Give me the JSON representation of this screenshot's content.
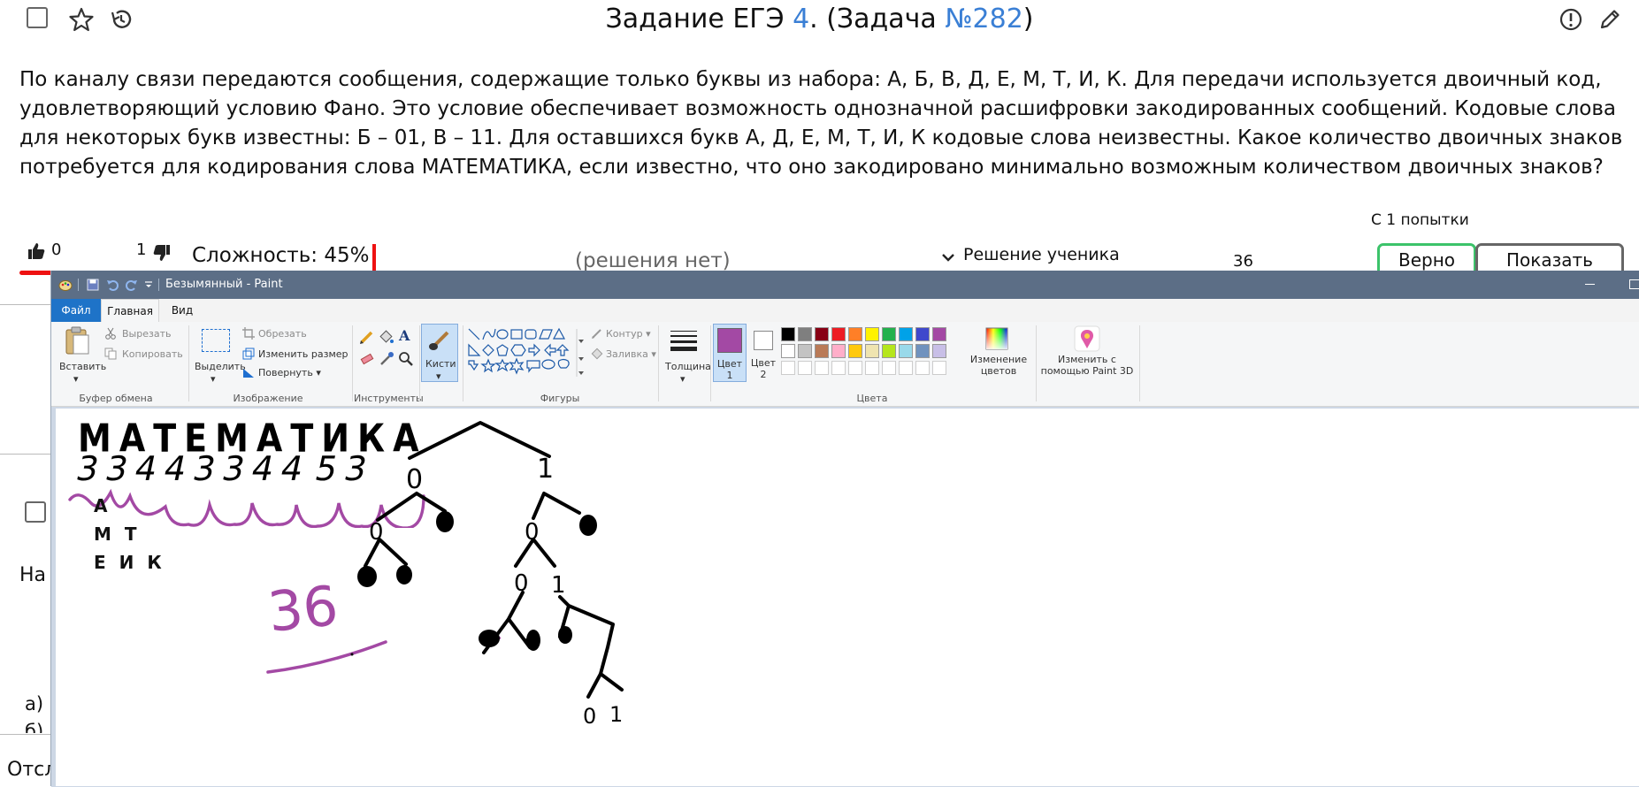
{
  "header": {
    "title_prefix": "Задание ЕГЭ ",
    "task_number": "4",
    "title_mid": ". (Задача ",
    "problem_id": "№282",
    "title_suffix": ")"
  },
  "task": {
    "text": "По каналу связи передаются сообщения, содержащие только буквы из набора: А, Б, В, Д, Е, М, Т, И, К. Для передачи используется двоичный код, удовлетворяющий условию Фано. Это условие обеспечивает возможность однозначной расшифровки закодированных сообщений. Кодовые слова для некоторых букв известны: Б – 01, В – 11. Для оставшихся букв А, Д, Е, М, Т, И, К кодовые слова неизвестны. Какое количество двоичных знаков потребуется для кодирования слова МАТЕМАТИКА, если известно, что оно закодировано минимально возможным количеством двоичных знаков?"
  },
  "stats": {
    "likes": "0",
    "dislikes": "1",
    "difficulty": "Сложность: 45%",
    "solutions": "(решения нет)",
    "student_solution": "Решение ученика",
    "answer_value": "36",
    "attempts": "С 1 попытки",
    "correct_label": "Верно",
    "show_answer_label": "Показать ответ"
  },
  "background_fragments": {
    "left_na": "На",
    "item_a": "а)",
    "item_b": "б)",
    "bottom": "Отсл"
  },
  "paint": {
    "window_title": "Безымянный - Paint",
    "tabs": [
      "Файл",
      "Главная",
      "Вид"
    ],
    "clipboard": {
      "paste": "Вставить",
      "cut": "Вырезать",
      "copy": "Копировать",
      "label": "Буфер обмена"
    },
    "image": {
      "select": "Выделить",
      "crop": "Обрезать",
      "resize": "Изменить размер",
      "rotate": "Повернуть",
      "label": "Изображение"
    },
    "tools": {
      "label": "Инструменты"
    },
    "brushes": {
      "label": "Кисти"
    },
    "shapes": {
      "outline": "Контур",
      "fill": "Заливка",
      "label": "Фигуры"
    },
    "size": {
      "label": "Толщина"
    },
    "color1": {
      "label": "Цвет 1"
    },
    "color2": {
      "label": "Цвет 2"
    },
    "edit_colors": "Изменение цветов",
    "paint3d": "Изменить с помощью Paint 3D",
    "colors_label": "Цвета",
    "palette": [
      "#000000",
      "#7f7f7f",
      "#880015",
      "#ed1c24",
      "#ff7f27",
      "#fff200",
      "#22b14c",
      "#00a2e8",
      "#3f48cc",
      "#a349a4",
      "#ffffff",
      "#c3c3c3",
      "#b97a57",
      "#ffaec9",
      "#ffc90e",
      "#efe4b0",
      "#b5e61d",
      "#99d9ea",
      "#7092be",
      "#c8bfe7"
    ],
    "color1_value": "#a349a4"
  },
  "drawing": {
    "word": "МАТЕМАТИКА",
    "digits": [
      "3",
      "3",
      "4",
      "4",
      "3",
      "3",
      "4",
      "4",
      "5",
      "3"
    ],
    "groups": [
      "А",
      "М Т",
      "Е И К"
    ],
    "total": "36",
    "tree_zero": "0",
    "tree_one": "1"
  }
}
